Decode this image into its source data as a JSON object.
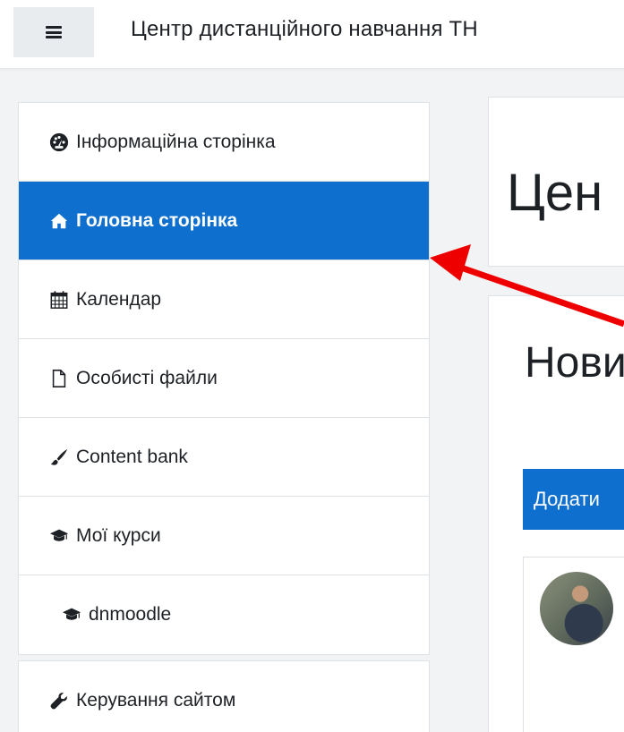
{
  "header": {
    "menu_toggle_icon": "hamburger-icon",
    "site_title": "Центр дистанційного навчання ТН"
  },
  "sidebar": {
    "items": [
      {
        "label": "Інформаційна сторінка",
        "icon": "tachometer-icon",
        "active": false
      },
      {
        "label": "Головна сторінка",
        "icon": "home-icon",
        "active": true
      },
      {
        "label": "Календар",
        "icon": "calendar-icon",
        "active": false
      },
      {
        "label": "Особисті файли",
        "icon": "file-icon",
        "active": false
      },
      {
        "label": "Content bank",
        "icon": "paintbrush-icon",
        "active": false
      },
      {
        "label": "Мої курси",
        "icon": "graduation-cap-icon",
        "active": false
      },
      {
        "label": "dnmoodle",
        "icon": "graduation-cap-icon",
        "active": false
      }
    ],
    "admin_items": [
      {
        "label": "Керування сайтом",
        "icon": "wrench-icon",
        "active": false
      }
    ]
  },
  "main": {
    "page_heading": "Цен",
    "news_heading": "Нови",
    "add_button_label": "Додати"
  },
  "colors": {
    "accent": "#0f6fce",
    "annotation_arrow": "#ee0000"
  }
}
